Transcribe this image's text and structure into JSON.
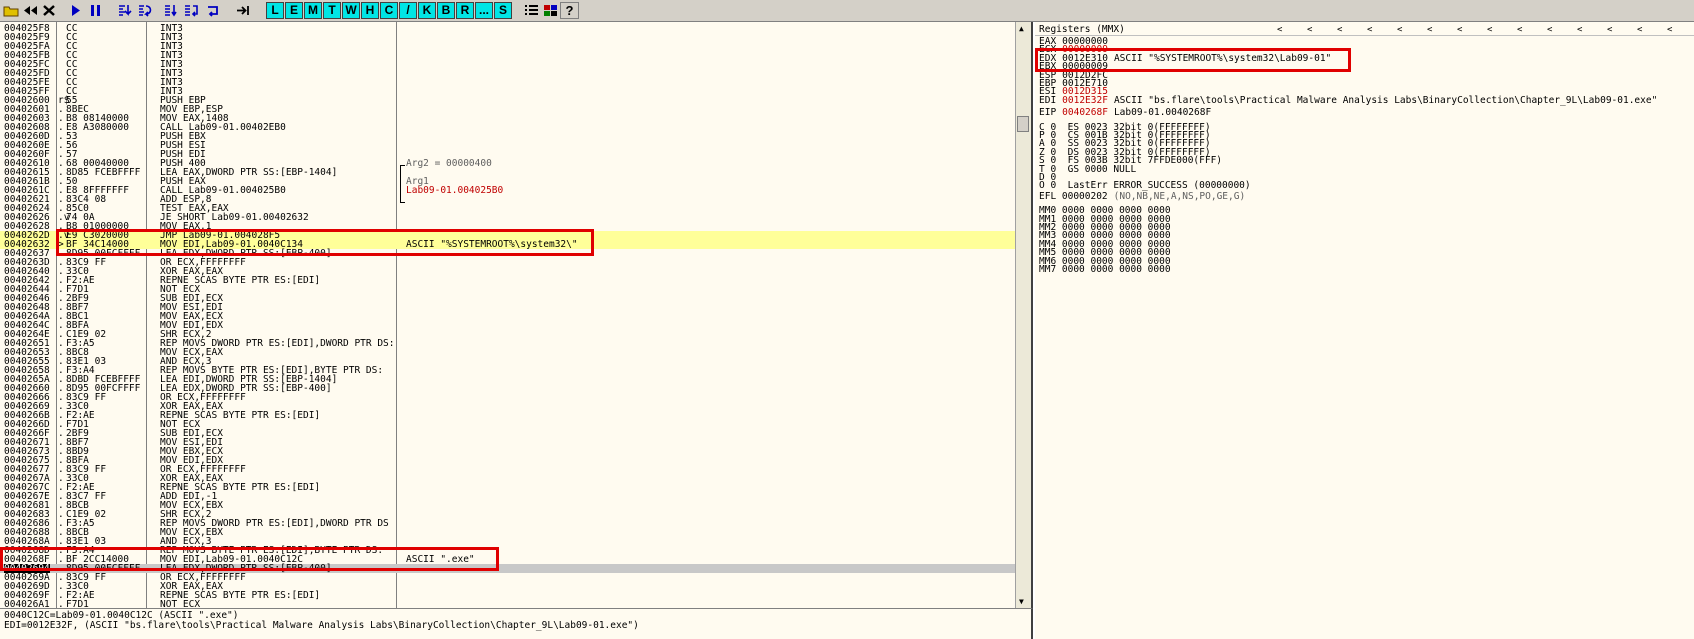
{
  "toolbar": {
    "letters": [
      "L",
      "E",
      "M",
      "T",
      "W",
      "H",
      "C",
      "/",
      "K",
      "B",
      "R",
      "...",
      "S"
    ]
  },
  "colors": {
    "highlight": "#ffff99",
    "annotation_box": "#e00000",
    "toolbar_letter_bg": "#00e5e5",
    "changed_reg": "#c00000"
  },
  "disasm": {
    "rows": [
      {
        "addr": "004025F8",
        "mk": "",
        "hex": "CC",
        "dis": "INT3",
        "cmt": ""
      },
      {
        "addr": "004025F9",
        "mk": "",
        "hex": "CC",
        "dis": "INT3",
        "cmt": ""
      },
      {
        "addr": "004025FA",
        "mk": "",
        "hex": "CC",
        "dis": "INT3",
        "cmt": ""
      },
      {
        "addr": "004025FB",
        "mk": "",
        "hex": "CC",
        "dis": "INT3",
        "cmt": ""
      },
      {
        "addr": "004025FC",
        "mk": "",
        "hex": "CC",
        "dis": "INT3",
        "cmt": ""
      },
      {
        "addr": "004025FD",
        "mk": "",
        "hex": "CC",
        "dis": "INT3",
        "cmt": ""
      },
      {
        "addr": "004025FE",
        "mk": "",
        "hex": "CC",
        "dis": "INT3",
        "cmt": ""
      },
      {
        "addr": "004025FF",
        "mk": "",
        "hex": "CC",
        "dis": "INT3",
        "cmt": ""
      },
      {
        "addr": "00402600",
        "mk": "r$",
        "hex": "55",
        "dis": "PUSH EBP",
        "cmt": ""
      },
      {
        "addr": "00402601",
        "mk": ".",
        "hex": "8BEC",
        "dis": "MOV EBP,ESP",
        "cmt": ""
      },
      {
        "addr": "00402603",
        "mk": ".",
        "hex": "B8 08140000",
        "dis": "MOV EAX,1408",
        "cmt": ""
      },
      {
        "addr": "00402608",
        "mk": ".",
        "hex": "E8 A3080000",
        "dis": "CALL Lab09-01.00402EB0",
        "cmt": ""
      },
      {
        "addr": "0040260D",
        "mk": ".",
        "hex": "53",
        "dis": "PUSH EBX",
        "cmt": ""
      },
      {
        "addr": "0040260E",
        "mk": ".",
        "hex": "56",
        "dis": "PUSH ESI",
        "cmt": ""
      },
      {
        "addr": "0040260F",
        "mk": ".",
        "hex": "57",
        "dis": "PUSH EDI",
        "cmt": ""
      },
      {
        "addr": "00402610",
        "mk": ".",
        "hex": "68 00040000",
        "dis": "PUSH 400",
        "cmt": "Arg2 = 00000400"
      },
      {
        "addr": "00402615",
        "mk": ".",
        "hex": "8D85 FCEBFFFF",
        "dis": "LEA EAX,DWORD PTR SS:[EBP-1404]",
        "cmt": ""
      },
      {
        "addr": "0040261B",
        "mk": ".",
        "hex": "50",
        "dis": "PUSH EAX",
        "cmt": "Arg1"
      },
      {
        "addr": "0040261C",
        "mk": ".",
        "hex": "E8 8FFFFFFF",
        "dis": "CALL Lab09-01.004025B0",
        "cmt": "Lab09-01.004025B0"
      },
      {
        "addr": "00402621",
        "mk": ".",
        "hex": "83C4 08",
        "dis": "ADD ESP,8",
        "cmt": ""
      },
      {
        "addr": "00402624",
        "mk": ".",
        "hex": "85C0",
        "dis": "TEST EAX,EAX",
        "cmt": ""
      },
      {
        "addr": "00402626",
        "mk": ".v",
        "hex": "74 0A",
        "dis": "JE SHORT Lab09-01.00402632",
        "cmt": ""
      },
      {
        "addr": "00402628",
        "mk": ".",
        "hex": "B8 01000000",
        "dis": "MOV EAX,1",
        "cmt": ""
      },
      {
        "addr": "0040262D",
        "mk": ".v",
        "hex": "E9 C3020000",
        "dis": "JMP Lab09-01.004028F5",
        "cmt": ""
      },
      {
        "addr": "00402632",
        "mk": ">",
        "hex": "BF 34C14000",
        "dis": "MOV EDI,Lab09-01.0040C134",
        "cmt": "ASCII \"%SYSTEMROOT%\\system32\\\""
      },
      {
        "addr": "00402637",
        "mk": ".",
        "hex": "8D95 00FCFFFF",
        "dis": "LEA EDX,DWORD PTR SS:[EBP-400]",
        "cmt": ""
      },
      {
        "addr": "0040263D",
        "mk": ".",
        "hex": "83C9 FF",
        "dis": "OR ECX,FFFFFFFF",
        "cmt": ""
      },
      {
        "addr": "00402640",
        "mk": ".",
        "hex": "33C0",
        "dis": "XOR EAX,EAX",
        "cmt": ""
      },
      {
        "addr": "00402642",
        "mk": ".",
        "hex": "F2:AE",
        "dis": "REPNE SCAS BYTE PTR ES:[EDI]",
        "cmt": ""
      },
      {
        "addr": "00402644",
        "mk": ".",
        "hex": "F7D1",
        "dis": "NOT ECX",
        "cmt": ""
      },
      {
        "addr": "00402646",
        "mk": ".",
        "hex": "2BF9",
        "dis": "SUB EDI,ECX",
        "cmt": ""
      },
      {
        "addr": "00402648",
        "mk": ".",
        "hex": "8BF7",
        "dis": "MOV ESI,EDI",
        "cmt": ""
      },
      {
        "addr": "0040264A",
        "mk": ".",
        "hex": "8BC1",
        "dis": "MOV EAX,ECX",
        "cmt": ""
      },
      {
        "addr": "0040264C",
        "mk": ".",
        "hex": "8BFA",
        "dis": "MOV EDI,EDX",
        "cmt": ""
      },
      {
        "addr": "0040264E",
        "mk": ".",
        "hex": "C1E9 02",
        "dis": "SHR ECX,2",
        "cmt": ""
      },
      {
        "addr": "00402651",
        "mk": ".",
        "hex": "F3:A5",
        "dis": "REP MOVS DWORD PTR ES:[EDI],DWORD PTR DS:",
        "cmt": ""
      },
      {
        "addr": "00402653",
        "mk": ".",
        "hex": "8BC8",
        "dis": "MOV ECX,EAX",
        "cmt": ""
      },
      {
        "addr": "00402655",
        "mk": ".",
        "hex": "83E1 03",
        "dis": "AND ECX,3",
        "cmt": ""
      },
      {
        "addr": "00402658",
        "mk": ".",
        "hex": "F3:A4",
        "dis": "REP MOVS BYTE PTR ES:[EDI],BYTE PTR DS:",
        "cmt": ""
      },
      {
        "addr": "0040265A",
        "mk": ".",
        "hex": "8DBD FCEBFFFF",
        "dis": "LEA EDI,DWORD PTR SS:[EBP-1404]",
        "cmt": ""
      },
      {
        "addr": "00402660",
        "mk": ".",
        "hex": "8D95 00FCFFFF",
        "dis": "LEA EDX,DWORD PTR SS:[EBP-400]",
        "cmt": ""
      },
      {
        "addr": "00402666",
        "mk": ".",
        "hex": "83C9 FF",
        "dis": "OR ECX,FFFFFFFF",
        "cmt": ""
      },
      {
        "addr": "00402669",
        "mk": ".",
        "hex": "33C0",
        "dis": "XOR EAX,EAX",
        "cmt": ""
      },
      {
        "addr": "0040266B",
        "mk": ".",
        "hex": "F2:AE",
        "dis": "REPNE SCAS BYTE PTR ES:[EDI]",
        "cmt": ""
      },
      {
        "addr": "0040266D",
        "mk": ".",
        "hex": "F7D1",
        "dis": "NOT ECX",
        "cmt": ""
      },
      {
        "addr": "0040266F",
        "mk": ".",
        "hex": "2BF9",
        "dis": "SUB EDI,ECX",
        "cmt": ""
      },
      {
        "addr": "00402671",
        "mk": ".",
        "hex": "8BF7",
        "dis": "MOV ESI,EDI",
        "cmt": ""
      },
      {
        "addr": "00402673",
        "mk": ".",
        "hex": "8BD9",
        "dis": "MOV EBX,ECX",
        "cmt": ""
      },
      {
        "addr": "00402675",
        "mk": ".",
        "hex": "8BFA",
        "dis": "MOV EDI,EDX",
        "cmt": ""
      },
      {
        "addr": "00402677",
        "mk": ".",
        "hex": "83C9 FF",
        "dis": "OR ECX,FFFFFFFF",
        "cmt": ""
      },
      {
        "addr": "0040267A",
        "mk": ".",
        "hex": "33C0",
        "dis": "XOR EAX,EAX",
        "cmt": ""
      },
      {
        "addr": "0040267C",
        "mk": ".",
        "hex": "F2:AE",
        "dis": "REPNE SCAS BYTE PTR ES:[EDI]",
        "cmt": ""
      },
      {
        "addr": "0040267E",
        "mk": ".",
        "hex": "83C7 FF",
        "dis": "ADD EDI,-1",
        "cmt": ""
      },
      {
        "addr": "00402681",
        "mk": ".",
        "hex": "8BCB",
        "dis": "MOV ECX,EBX",
        "cmt": ""
      },
      {
        "addr": "00402683",
        "mk": ".",
        "hex": "C1E9 02",
        "dis": "SHR ECX,2",
        "cmt": ""
      },
      {
        "addr": "00402686",
        "mk": ".",
        "hex": "F3:A5",
        "dis": "REP MOVS DWORD PTR ES:[EDI],DWORD PTR DS",
        "cmt": ""
      },
      {
        "addr": "00402688",
        "mk": ".",
        "hex": "8BCB",
        "dis": "MOV ECX,EBX",
        "cmt": ""
      },
      {
        "addr": "0040268A",
        "mk": ".",
        "hex": "83E1 03",
        "dis": "AND ECX,3",
        "cmt": ""
      },
      {
        "addr": "0040268D",
        "mk": ".",
        "hex": "F3:A4",
        "dis": "REP MOVS BYTE PTR ES:[EDI],BYTE PTR DS:",
        "cmt": ""
      },
      {
        "addr": "0040268F",
        "mk": ".",
        "hex": "BF 2CC14000",
        "dis": "MOV EDI,Lab09-01.0040C12C",
        "cmt": "ASCII \".exe\""
      },
      {
        "addr": "00402694",
        "mk": ".",
        "hex": "8D95 00FCFFFF",
        "dis": "LEA EDX,DWORD PTR SS:[EBP-400]",
        "cmt": ""
      },
      {
        "addr": "0040269A",
        "mk": ".",
        "hex": "83C9 FF",
        "dis": "OR ECX,FFFFFFFF",
        "cmt": ""
      },
      {
        "addr": "0040269D",
        "mk": ".",
        "hex": "33C0",
        "dis": "XOR EAX,EAX",
        "cmt": ""
      },
      {
        "addr": "0040269F",
        "mk": ".",
        "hex": "F2:AE",
        "dis": "REPNE SCAS BYTE PTR ES:[EDI]",
        "cmt": ""
      },
      {
        "addr": "004026A1",
        "mk": ".",
        "hex": "F7D1",
        "dis": "NOT ECX",
        "cmt": ""
      }
    ]
  },
  "info": {
    "line1": "0040C12C=Lab09-01.0040C12C (ASCII \".exe\")",
    "line2": "EDI=0012E32F, (ASCII \"bs.flare\\tools\\Practical Malware Analysis Labs\\BinaryCollection\\Chapter_9L\\Lab09-01.exe\")"
  },
  "registers": {
    "title": "Registers (MMX)",
    "lines": [
      {
        "name": "EAX",
        "value": "00000000",
        "comment": "",
        "changed": false
      },
      {
        "name": "ECX",
        "value": "00000009",
        "comment": "",
        "changed": true
      },
      {
        "name": "EDX",
        "value": "0012E310",
        "comment": "ASCII \"%SYSTEMROOT%\\system32\\Lab09-01\"",
        "changed": false
      },
      {
        "name": "EBX",
        "value": "00000009",
        "comment": "",
        "changed": false
      },
      {
        "name": "ESP",
        "value": "0012D2FC",
        "comment": "",
        "changed": false
      },
      {
        "name": "EBP",
        "value": "0012E710",
        "comment": "",
        "changed": false
      },
      {
        "name": "ESI",
        "value": "0012D315",
        "comment": "",
        "changed": true
      },
      {
        "name": "EDI",
        "value": "0012E32F",
        "comment": "ASCII \"bs.flare\\tools\\Practical Malware Analysis Labs\\BinaryCollection\\Chapter_9L\\Lab09-01.exe\"",
        "changed": true
      }
    ],
    "eip": {
      "name": "EIP",
      "value": "0040268F",
      "comment": "Lab09-01.0040268F"
    },
    "flags": [
      "C 0  ES 0023 32bit 0(FFFFFFFF)",
      "P 0  CS 001B 32bit 0(FFFFFFFF)",
      "A 0  SS 0023 32bit 0(FFFFFFFF)",
      "Z 0  DS 0023 32bit 0(FFFFFFFF)",
      "S 0  FS 003B 32bit 7FFDE000(FFF)",
      "T 0  GS 0000 NULL",
      "D 0",
      "O 0  LastErr ERROR_SUCCESS (00000000)"
    ],
    "efl": {
      "label": "EFL 00000202",
      "detail": "(NO,NB,NE,A,NS,PO,GE,G)"
    },
    "mmx": [
      "MM0 0000 0000 0000 0000",
      "MM1 0000 0000 0000 0000",
      "MM2 0000 0000 0000 0000",
      "MM3 0000 0000 0000 0000",
      "MM4 0000 0000 0000 0000",
      "MM5 0000 0000 0000 0000",
      "MM6 0000 0000 0000 0000",
      "MM7 0000 0000 0000 0000"
    ]
  }
}
